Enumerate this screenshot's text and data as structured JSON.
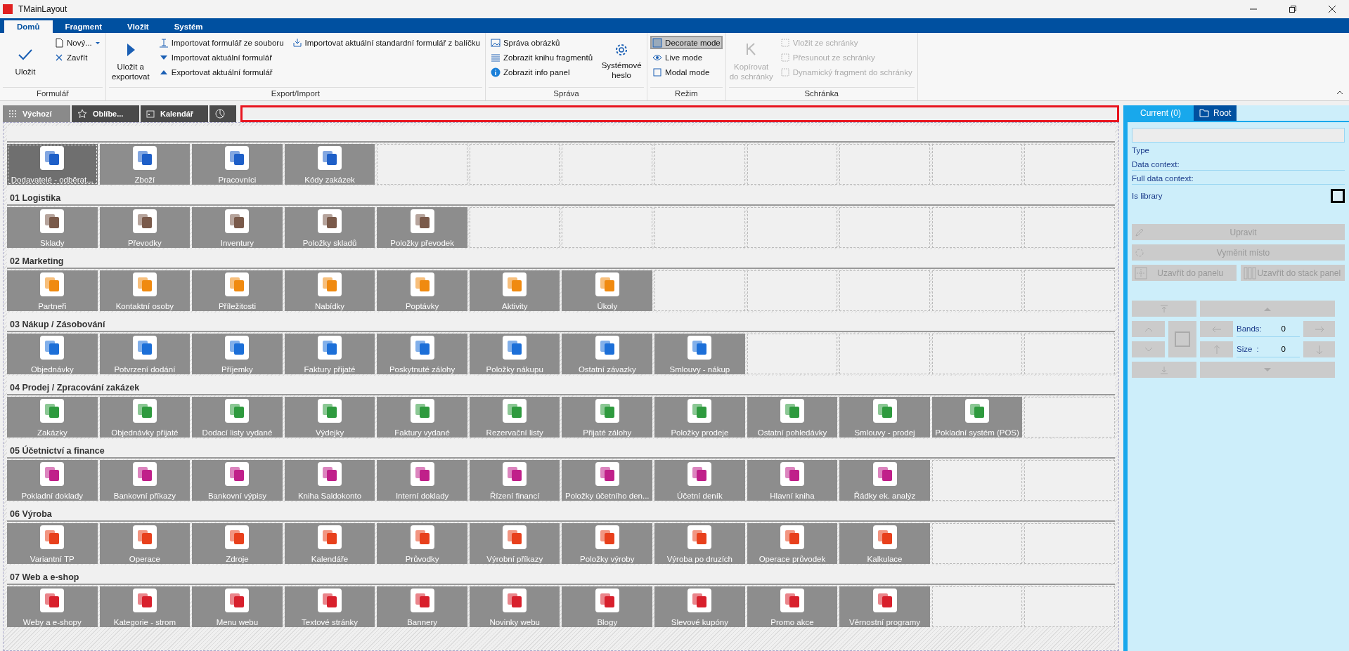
{
  "window": {
    "title": "TMainLayout"
  },
  "ribbon": {
    "tabs": [
      {
        "label": "Domů",
        "selected": true
      },
      {
        "label": "Fragment",
        "selected": false
      },
      {
        "label": "Vložit",
        "selected": false
      },
      {
        "label": "Systém",
        "selected": false
      }
    ],
    "formular": {
      "label": "Formulář",
      "save": "Uložit",
      "new": "Nový...",
      "close": "Zavřít"
    },
    "export_import": {
      "label": "Export/Import",
      "save_export": "Uložit a exportovat",
      "items": [
        "Importovat formulář ze souboru",
        "Importovat aktuální formulář",
        "Exportovat aktuální formulář"
      ],
      "package": "Importovat aktuální standardní formulář z balíčku"
    },
    "sprava": {
      "label": "Správa",
      "items": [
        "Správa obrázků",
        "Zobrazit knihu fragmentů",
        "Zobrazit info panel"
      ],
      "password": "Systémové heslo"
    },
    "rezim": {
      "label": "Režim",
      "modes": [
        {
          "label": "Decorate mode",
          "selected": true
        },
        {
          "label": "Live mode",
          "selected": false
        },
        {
          "label": "Modal mode",
          "selected": false
        }
      ]
    },
    "schranka": {
      "label": "Schránka",
      "copy": {
        "label": "Kopírovat do schránky",
        "disabled": true
      },
      "items": [
        {
          "label": "Vložit ze schránky",
          "disabled": true
        },
        {
          "label": "Přesunout ze schránky",
          "disabled": true
        },
        {
          "label": "Dynamický fragment do schránky",
          "disabled": true
        }
      ]
    }
  },
  "content_tabs": [
    {
      "label": "Výchozí",
      "selected": true
    },
    {
      "label": "Oblíbe...",
      "selected": false
    },
    {
      "label": "Kalendář",
      "selected": false
    },
    {
      "selected": false
    }
  ],
  "sections": [
    {
      "color": "#1e5fc8",
      "tiles": [
        {
          "label": "Dodavatelé - odběrat...",
          "selected": true
        },
        {
          "label": "Zboží",
          "selected": false
        },
        {
          "label": "Pracovníci",
          "selected": false
        },
        {
          "label": "Kódy zakázek",
          "selected": false
        }
      ]
    },
    {
      "title": "01 Logistika",
      "color": "#7a5a4a",
      "tiles": [
        {
          "label": "Sklady",
          "selected": false
        },
        {
          "label": "Převodky",
          "selected": false
        },
        {
          "label": "Inventury",
          "selected": false
        },
        {
          "label": "Položky skladů",
          "selected": false
        },
        {
          "label": "Položky převodek",
          "selected": false
        }
      ]
    },
    {
      "title": "02 Marketing",
      "color": "#f08a10",
      "tiles": [
        {
          "label": "Partneři",
          "selected": false
        },
        {
          "label": "Kontaktní osoby",
          "selected": false
        },
        {
          "label": "Příležitosti",
          "selected": false
        },
        {
          "label": "Nabídky",
          "selected": false
        },
        {
          "label": "Poptávky",
          "selected": false
        },
        {
          "label": "Aktivity",
          "selected": false
        },
        {
          "label": "Úkoly",
          "selected": false
        }
      ]
    },
    {
      "title": "03 Nákup / Zásobování",
      "color": "#1c6fd8",
      "tiles": [
        {
          "label": "Objednávky",
          "selected": false
        },
        {
          "label": "Potvrzení dodání",
          "selected": false
        },
        {
          "label": "Příjemky",
          "selected": false
        },
        {
          "label": "Faktury přijaté",
          "selected": false
        },
        {
          "label": "Poskytnuté zálohy",
          "selected": false
        },
        {
          "label": "Položky nákupu",
          "selected": false
        },
        {
          "label": "Ostatní závazky",
          "selected": false
        },
        {
          "label": "Smlouvy - nákup",
          "selected": false
        }
      ]
    },
    {
      "title": "04 Prodej / Zpracování zakázek",
      "color": "#2e9a3e",
      "tiles": [
        {
          "label": "Zakázky",
          "selected": false
        },
        {
          "label": "Objednávky přijaté",
          "selected": false
        },
        {
          "label": "Dodací listy vydané",
          "selected": false
        },
        {
          "label": "Výdejky",
          "selected": false
        },
        {
          "label": "Faktury vydané",
          "selected": false
        },
        {
          "label": "Rezervační listy",
          "selected": false
        },
        {
          "label": "Přijaté zálohy",
          "selected": false
        },
        {
          "label": "Položky prodeje",
          "selected": false
        },
        {
          "label": "Ostatní pohledávky",
          "selected": false
        },
        {
          "label": "Smlouvy - prodej",
          "selected": false
        },
        {
          "label": "Pokladní systém (POS)",
          "selected": false
        }
      ]
    },
    {
      "title": "05 Účetnictví a finance",
      "color": "#c0208a",
      "tiles": [
        {
          "label": "Pokladní doklady",
          "selected": false
        },
        {
          "label": "Bankovní příkazy",
          "selected": false
        },
        {
          "label": "Bankovní výpisy",
          "selected": false
        },
        {
          "label": "Kniha Saldokonto",
          "selected": false
        },
        {
          "label": "Interní doklady",
          "selected": false
        },
        {
          "label": "Řízení financí",
          "selected": false
        },
        {
          "label": "Položky účetního den...",
          "selected": false
        },
        {
          "label": "Účetní deník",
          "selected": false
        },
        {
          "label": "Hlavní kniha",
          "selected": false
        },
        {
          "label": "Řádky ek. analýz",
          "selected": false
        }
      ]
    },
    {
      "title": "06 Výroba",
      "color": "#e8401c",
      "tiles": [
        {
          "label": "Variantní TP",
          "selected": false
        },
        {
          "label": "Operace",
          "selected": false
        },
        {
          "label": "Zdroje",
          "selected": false
        },
        {
          "label": "Kalendáře",
          "selected": false
        },
        {
          "label": "Průvodky",
          "selected": false
        },
        {
          "label": "Výrobní příkazy",
          "selected": false
        },
        {
          "label": "Položky výroby",
          "selected": false
        },
        {
          "label": "Výroba po druzích",
          "selected": false
        },
        {
          "label": "Operace průvodek",
          "selected": false
        },
        {
          "label": "Kalkulace",
          "selected": false
        }
      ]
    },
    {
      "title": "07 Web a e-shop",
      "color": "#d8202c",
      "tiles": [
        {
          "label": "Weby a e-shopy",
          "selected": false
        },
        {
          "label": "Kategorie - strom",
          "selected": false
        },
        {
          "label": "Menu webu",
          "selected": false
        },
        {
          "label": "Textové stránky",
          "selected": false
        },
        {
          "label": "Bannery",
          "selected": false
        },
        {
          "label": "Novinky webu",
          "selected": false
        },
        {
          "label": "Blogy",
          "selected": false
        },
        {
          "label": "Slevové kupóny",
          "selected": false
        },
        {
          "label": "Promo akce",
          "selected": false
        },
        {
          "label": "Věrnostní programy",
          "selected": false
        }
      ]
    }
  ],
  "properties": {
    "tabs": [
      {
        "label": "Current (0)",
        "selected": true
      },
      {
        "label": "Root",
        "selected": false
      }
    ],
    "fields": [
      "Type",
      "Data context:",
      "Full data context:"
    ],
    "is_library": {
      "label": "Is library",
      "checked": false
    },
    "buttons": [
      {
        "label": "Upravit",
        "disabled": true
      },
      {
        "label": "Vyměnit místo",
        "disabled": true
      },
      {
        "label": "Uzavřít do panelu",
        "disabled": true
      },
      {
        "label": "Uzavřít do stack panel",
        "disabled": true
      }
    ],
    "bands": {
      "label": "Bands:",
      "value": "0"
    },
    "size": {
      "label": "Size",
      "separator": ":",
      "value": "0"
    }
  }
}
